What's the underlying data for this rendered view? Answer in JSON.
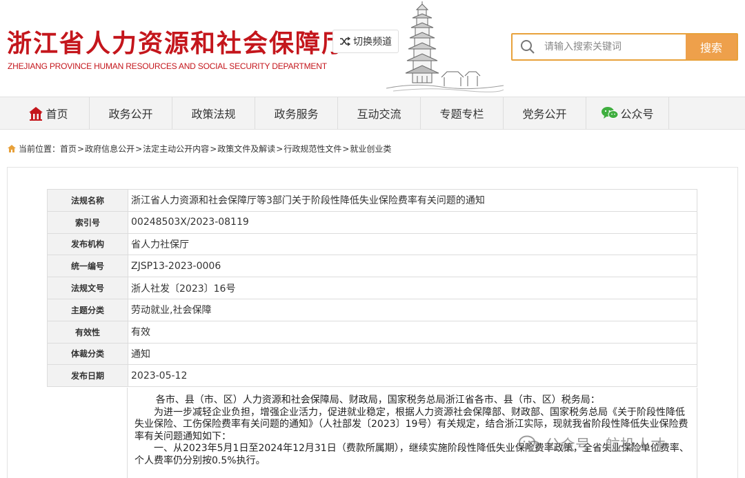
{
  "header": {
    "title": "浙江省人力资源和社会保障厅",
    "subtitle": "ZHEJIANG PROVINCE HUMAN RESOURCES AND SOCIAL SECURITY DEPARTMENT",
    "switch_label": "切换频道",
    "search_placeholder": "请输入搜索关键词",
    "search_button": "搜索"
  },
  "nav": {
    "items": [
      {
        "label": "首页",
        "icon": "home-icon"
      },
      {
        "label": "政务公开"
      },
      {
        "label": "政策法规"
      },
      {
        "label": "政务服务"
      },
      {
        "label": "互动交流"
      },
      {
        "label": "专题专栏"
      },
      {
        "label": "党务公开"
      },
      {
        "label": "公众号",
        "icon": "wechat-icon"
      }
    ]
  },
  "breadcrumb": {
    "prefix": "当前位置：",
    "items": [
      "首页",
      "政府信息公开",
      "法定主动公开内容",
      "政策文件及解读",
      "行政规范性文件",
      "就业创业类"
    ],
    "separator": ">"
  },
  "meta": {
    "rows": [
      {
        "key": "法规名称",
        "value": "浙江省人力资源和社会保障厅等3部门关于阶段性降低失业保险费率有关问题的通知"
      },
      {
        "key": "索引号",
        "value": "00248503X/2023-08119"
      },
      {
        "key": "发布机构",
        "value": "省人力社保厅"
      },
      {
        "key": "统一编号",
        "value": "ZJSP13-2023-0006"
      },
      {
        "key": "法规文号",
        "value": "浙人社发〔2023〕16号"
      },
      {
        "key": "主题分类",
        "value": "劳动就业,社会保障"
      },
      {
        "key": "有效性",
        "value": "有效"
      },
      {
        "key": "体裁分类",
        "value": "通知"
      },
      {
        "key": "发布日期",
        "value": "2023-05-12"
      }
    ]
  },
  "body": {
    "paragraphs": [
      "各市、县（市、区）人力资源和社会保障局、财政局，国家税务总局浙江省各市、县（市、区）税务局：",
      "为进一步减轻企业负担，增强企业活力，促进就业稳定，根据人力资源社会保障部、财政部、国家税务总局《关于阶段性降低失业保险、工伤保险费率有关问题的通知》（人社部发〔2023〕19号）有关规定，结合浙江实际，现就我省阶段性降低失业保险费率有关问题通知如下：",
      "一、从2023年5月1日至2024年12月31日（费款所属期），继续实施阶段性降低失业保险费率政策，全省失业保险单位费率、个人费率仍分别按0.5%执行。"
    ]
  },
  "watermark": {
    "text": "公众号 · 航投人才"
  },
  "colors": {
    "brand_red": "#c4161c",
    "search_orange": "#eea04b",
    "nav_bg": "#f3f3f3"
  }
}
